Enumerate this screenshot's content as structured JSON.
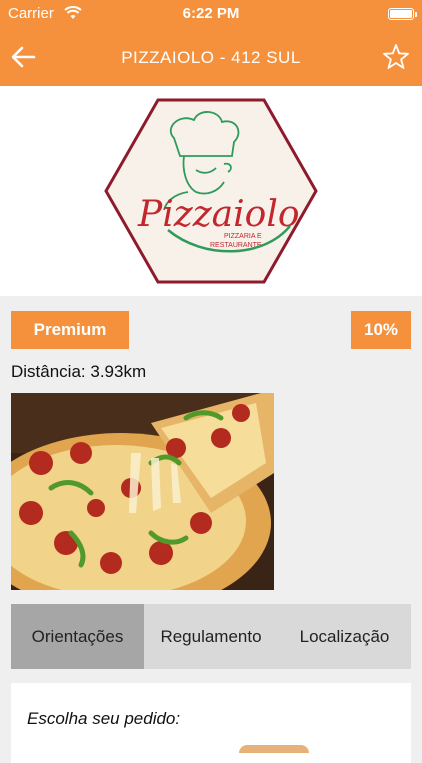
{
  "status_bar": {
    "carrier": "Carrier",
    "time": "6:22 PM"
  },
  "nav": {
    "title": "PIZZAIOLO - 412 SUL",
    "back_icon": "back-arrow-icon",
    "favorite_icon": "star-outline-icon"
  },
  "logo": {
    "brand": "Pizzaiolo",
    "tagline_line1": "PIZZARIA E",
    "tagline_line2": "RESTAURANTE",
    "colors": {
      "frame": "#8e1b2c",
      "script": "#c2272d",
      "chef": "#2f9a5c",
      "swoosh": "#2f9a5c"
    }
  },
  "badges": {
    "tier": "Premium",
    "discount": "10%"
  },
  "distance": "Distância: 3.93km",
  "tabs": [
    {
      "label": "Orientações",
      "active": true
    },
    {
      "label": "Regulamento",
      "active": false
    },
    {
      "label": "Localização",
      "active": false
    }
  ],
  "order": {
    "prompt": "Escolha seu pedido:"
  },
  "colors": {
    "accent": "#f5913d",
    "tab_bg": "#d9d9d9",
    "tab_active": "#a6a6a6",
    "page_bg": "#efefef"
  }
}
